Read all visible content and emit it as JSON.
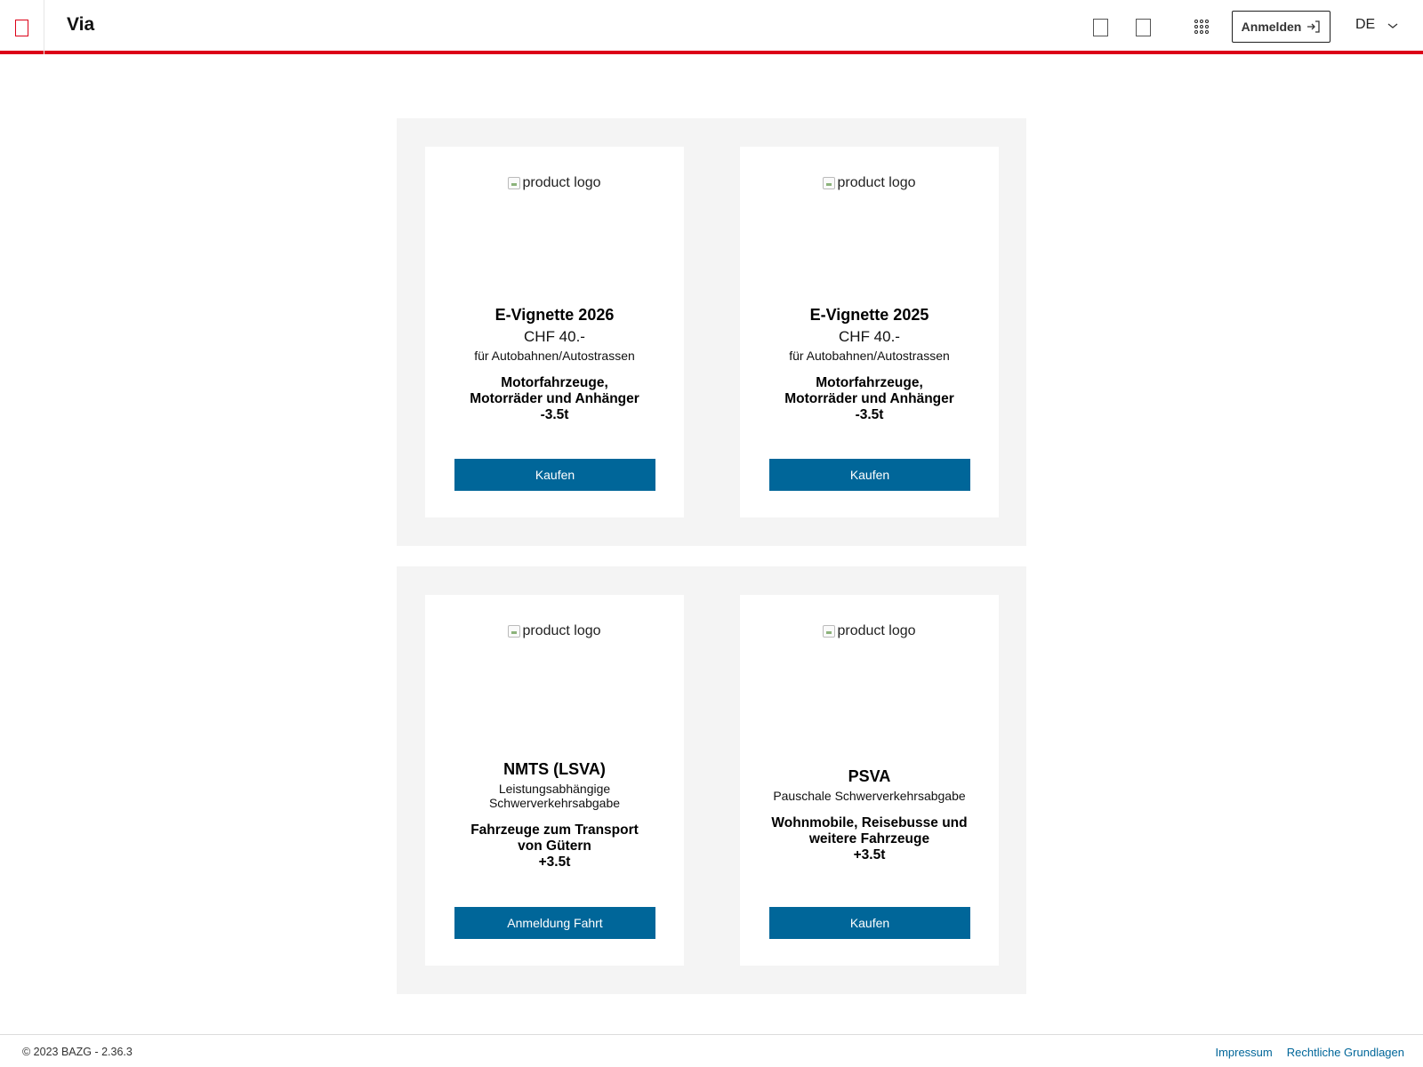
{
  "header": {
    "app_title": "Via",
    "login_label": "Anmelden",
    "login_icon": "login-arrow-icon",
    "language": "DE",
    "icons": [
      "brand-placeholder-icon",
      "square-icon",
      "square-icon",
      "apps-grid-icon",
      "chevron-down-icon"
    ],
    "accent_color": "#dc0018"
  },
  "products": [
    {
      "logo_alt": "product logo",
      "title": "E-Vignette 2026",
      "price": "CHF 40.-",
      "subtitle": "für Autobahnen/Autostrassen",
      "vehicles": [
        "Motorfahrzeuge,",
        "Motorräder und Anhänger",
        "-3.5t"
      ],
      "button": "Kaufen"
    },
    {
      "logo_alt": "product logo",
      "title": "E-Vignette 2025",
      "price": "CHF 40.-",
      "subtitle": "für Autobahnen/Autostrassen",
      "vehicles": [
        "Motorfahrzeuge,",
        "Motorräder und Anhänger",
        "-3.5t"
      ],
      "button": "Kaufen"
    },
    {
      "logo_alt": "product logo",
      "title": "NMTS (LSVA)",
      "subtitle_lines": [
        "Leistungsabhängige",
        "Schwerverkehrsabgabe"
      ],
      "vehicles": [
        "Fahrzeuge zum Transport",
        "von Gütern",
        "+3.5t"
      ],
      "button": "Anmeldung Fahrt"
    },
    {
      "logo_alt": "product logo",
      "title": "PSVA",
      "subtitle": "Pauschale Schwerverkehrsabgabe",
      "vehicles": [
        "Wohnmobile, Reisebusse und",
        "weitere Fahrzeuge",
        "+3.5t"
      ],
      "button": "Kaufen"
    }
  ],
  "footer": {
    "copyright": "© 2023 BAZG - 2.36.3",
    "links": [
      "Impressum",
      "Rechtliche Grundlagen"
    ],
    "link_color": "#006699"
  },
  "colors": {
    "button_bg": "#006699",
    "section_bg": "#f4f4f4"
  }
}
